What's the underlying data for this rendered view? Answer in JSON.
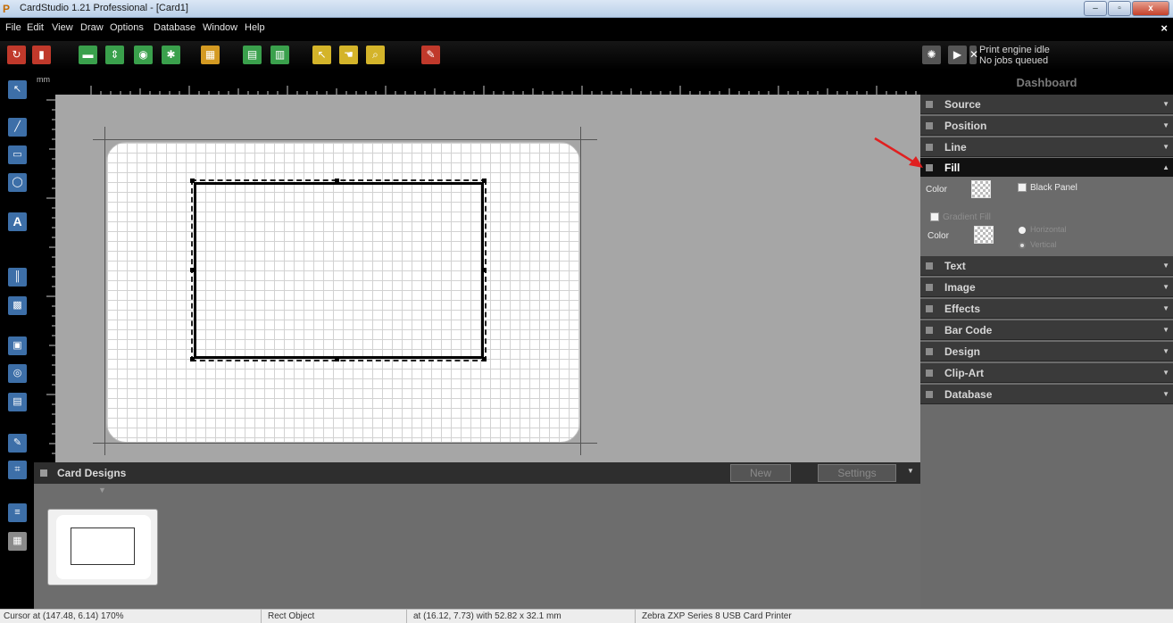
{
  "window": {
    "title": "CardStudio 1.21 Professional - [Card1]",
    "controls": {
      "minimize": "–",
      "maximize": "▫",
      "close": "x"
    }
  },
  "menu": {
    "items": [
      "File",
      "Edit",
      "View",
      "Draw",
      "Options",
      "Database",
      "Window",
      "Help"
    ],
    "close": "×"
  },
  "print_engine": {
    "line1": "Print engine idle",
    "line2": "No jobs queued"
  },
  "ruler": {
    "unit": "mm"
  },
  "dashboard": {
    "title": "Dashboard",
    "sections": {
      "source": "Source",
      "position": "Position",
      "line": "Line",
      "fill": "Fill",
      "text": "Text",
      "image": "Image",
      "effects": "Effects",
      "barcode": "Bar Code",
      "design": "Design",
      "clipart": "Clip-Art",
      "database": "Database"
    },
    "fill_panel": {
      "color_label": "Color",
      "black_panel_label": "Black Panel",
      "gradient_fill_label": "Gradient Fill",
      "gradient_color_label": "Color",
      "horizontal_label": "Horizontal",
      "vertical_label": "Vertical"
    }
  },
  "card_designs": {
    "title": "Card Designs",
    "new_button": "New",
    "settings_button": "Settings"
  },
  "statusbar": {
    "cursor": "Cursor at (147.48, 6.14) 170%",
    "object": "Rect Object",
    "geometry": "at (16.12, 7.73) with 52.82 x 32.1 mm",
    "printer": "Zebra ZXP Series 8 USB Card Printer"
  }
}
